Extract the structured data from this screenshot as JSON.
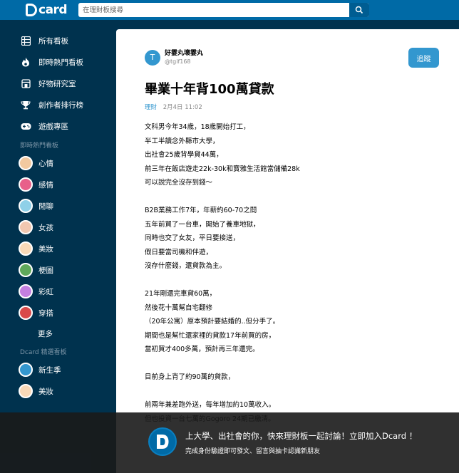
{
  "header": {
    "logo_text": "card",
    "search_placeholder": "在理財板搜尋"
  },
  "sidebar": {
    "nav": [
      {
        "label": "所有看板",
        "icon": "grid-icon"
      },
      {
        "label": "即時熱門看板",
        "icon": "flame-icon"
      },
      {
        "label": "好物研究室",
        "icon": "shop-icon"
      },
      {
        "label": "創作者排行榜",
        "icon": "trophy-icon"
      },
      {
        "label": "遊戲專區",
        "icon": "gamepad-icon"
      }
    ],
    "hot_section_label": "即時熱門看板",
    "hot_boards": [
      {
        "label": "心情",
        "color": "#f2c9a0"
      },
      {
        "label": "感情",
        "color": "#e8608a"
      },
      {
        "label": "閒聊",
        "color": "#8fd0e8"
      },
      {
        "label": "女孩",
        "color": "#f1c7b0"
      },
      {
        "label": "美妝",
        "color": "#f9d9b8"
      },
      {
        "label": "梗圖",
        "color": "#5fa85a"
      },
      {
        "label": "彩虹",
        "color": "#c47fe0"
      },
      {
        "label": "穿搭",
        "color": "#d94a4a"
      }
    ],
    "more_label": "更多",
    "featured_section_label": "Dcard 精選看板",
    "featured_boards": [
      {
        "label": "新生季",
        "color": "#3397cf"
      },
      {
        "label": "美妝",
        "color": "#f9d9b8"
      }
    ]
  },
  "post": {
    "author_initial": "T",
    "author_name": "好霎丸壞霎丸",
    "author_handle": "@tgif168",
    "follow_label": "追蹤",
    "title": "畢業十年背100萬貸款",
    "forum": "理財",
    "date": "2月4日 11:02",
    "lines": [
      "文科男今年34歲，18歲開始打工，",
      "半工半讀念外縣市大學，",
      "出社會25歲背學貸44萬，",
      "前三年在飯店遊走22k-30k和寶雅生活館當儲備28k",
      "可以說完全沒存到錢～",
      "",
      "B2B業務工作7年，年薪約60-70之間",
      "五年前買了一台車，開始了養車地獄，",
      "同時也交了女友，平日要接送，",
      "假日要當司機和伴遊，",
      "沒存什麼錢，還貸款為主。",
      "",
      "21年剛還完車貸60萬，",
      "然後花十萬幫自宅翻修",
      "（20年公寓）原本預計要結婚的..但分手了。",
      "期間也是幫忙還家裡的貸款17年前買的房，",
      "當初買才400多萬，預計再三年還完。",
      "",
      "目前身上背了約90萬的貸款，",
      "",
      "前兩年兼差跑外送，每年增加約10萬收入。",
      "但也投資一台七萬的Gogoro 24期已繳清。"
    ]
  },
  "banner": {
    "title": "上大學、出社會的你，快來理財板一起討論！立即加入Dcard ！",
    "subtitle": "完成身份驗證即可發文、留言與抽卡認識新朋友"
  }
}
